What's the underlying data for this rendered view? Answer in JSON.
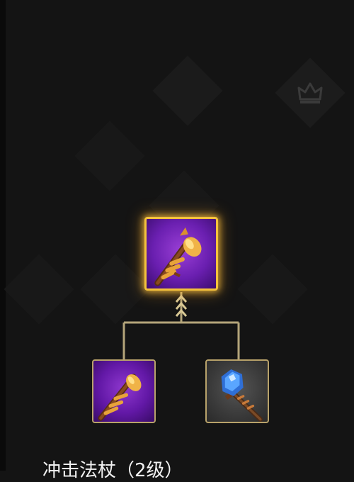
{
  "recipe_tree": {
    "result_item": {
      "icon": "golden-wand-icon",
      "rarity_color": "#7a2cc4",
      "frame_color": "#f4c23c",
      "selected": true
    },
    "components": [
      {
        "icon": "golden-wand-icon",
        "rarity_color": "#6a1fb0",
        "frame_color": "#b8a26a"
      },
      {
        "icon": "blue-crystal-wand-icon",
        "rarity_color": "#3a3a3a",
        "frame_color": "#b8a26a"
      }
    ],
    "connector_color": "#b4a57a"
  },
  "background": {
    "locked_slot_icon": "crown-icon"
  },
  "bottom_label": "冲击法杖（2级）"
}
